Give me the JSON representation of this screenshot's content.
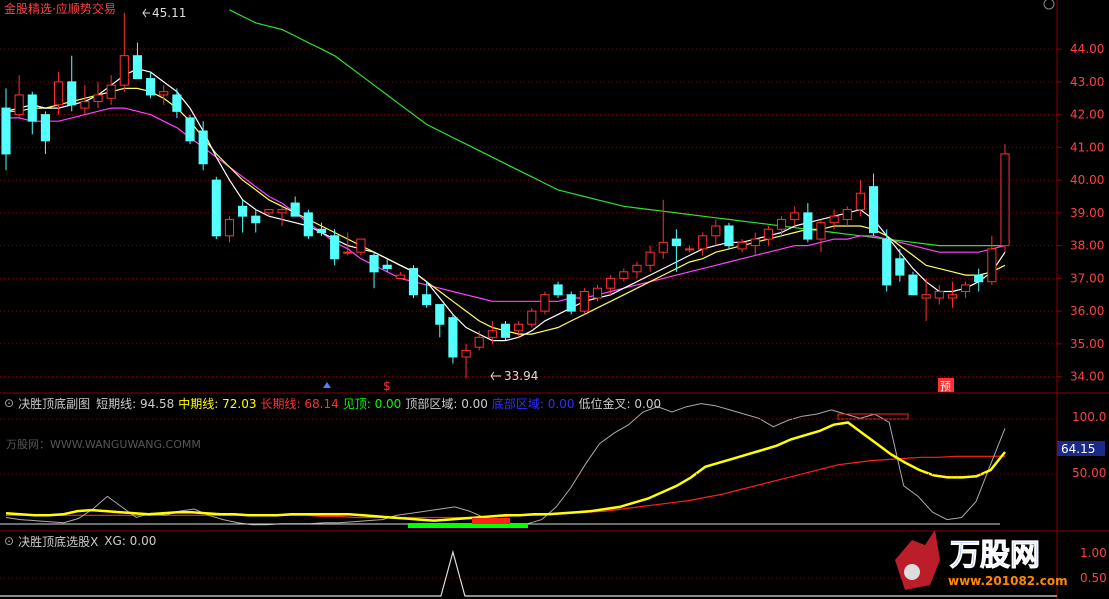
{
  "main_title": "金股精选·应顺势交易",
  "price_axis": {
    "labels": [
      "44.00",
      "43.00",
      "42.00",
      "41.00",
      "40.00",
      "39.00",
      "38.00",
      "37.00",
      "36.00",
      "35.00",
      "34.00"
    ]
  },
  "annotations": {
    "high_label": "45.11",
    "low_label": "33.94",
    "dollar_marker": "$",
    "yu_marker": "预"
  },
  "indicator1": {
    "name": "决胜顶底副图",
    "items": [
      {
        "label": "短期线:",
        "value": "94.58",
        "color": "#cccccc"
      },
      {
        "label": "中期线:",
        "value": "72.03",
        "color": "#ffff00"
      },
      {
        "label": "长期线:",
        "value": "68.14",
        "color": "#ff3030"
      },
      {
        "label": "见顶:",
        "value": "0.00",
        "color": "#00ff00"
      },
      {
        "label": "顶部区域:",
        "value": "0.00",
        "color": "#cccccc"
      },
      {
        "label": "底部区域:",
        "value": "0.00",
        "color": "#3030ff"
      },
      {
        "label": "低位金叉:",
        "value": "0.00",
        "color": "#cccccc"
      }
    ],
    "axis_labels": [
      "100.0",
      "50.00"
    ],
    "current_tag": "64.15",
    "watermark": "万股网：WWW.WANGUWANG.COMM"
  },
  "indicator2": {
    "name": "决胜顶底选股X",
    "items": [
      {
        "label": "XG:",
        "value": "0.00",
        "color": "#cccccc"
      }
    ],
    "axis_labels": [
      "1.00",
      "0.50"
    ]
  },
  "brand": {
    "name": "万股网",
    "url": "www.201082.com"
  },
  "colors": {
    "up": "#ff3030",
    "down": "#54ffff",
    "ma5": "#ffffff",
    "ma10": "#ffff60",
    "ma20": "#ff40ff",
    "ma60": "#30e030",
    "grid": "#8b0000"
  },
  "chart_data": {
    "type": "candlestick",
    "ylim": [
      33.5,
      45.5
    ],
    "candles": [
      [
        42.2,
        42.8,
        40.3,
        40.8
      ],
      [
        42.0,
        43.2,
        41.9,
        42.6
      ],
      [
        42.6,
        42.7,
        41.4,
        41.8
      ],
      [
        42.0,
        42.1,
        40.8,
        41.2
      ],
      [
        42.3,
        43.3,
        42.0,
        43.0
      ],
      [
        43.0,
        43.8,
        42.1,
        42.3
      ],
      [
        42.2,
        42.9,
        42.0,
        42.4
      ],
      [
        42.4,
        43.0,
        42.2,
        42.6
      ],
      [
        42.5,
        43.2,
        42.3,
        42.9
      ],
      [
        42.9,
        45.11,
        42.7,
        43.8
      ],
      [
        43.8,
        44.2,
        43.1,
        43.1
      ],
      [
        43.1,
        43.3,
        42.5,
        42.6
      ],
      [
        42.6,
        42.9,
        42.3,
        42.7
      ],
      [
        42.6,
        42.8,
        41.9,
        42.1
      ],
      [
        41.9,
        42.0,
        41.1,
        41.2
      ],
      [
        41.5,
        41.8,
        40.3,
        40.5
      ],
      [
        40.0,
        40.1,
        38.2,
        38.3
      ],
      [
        38.3,
        38.9,
        38.1,
        38.8
      ],
      [
        39.2,
        39.4,
        38.4,
        38.9
      ],
      [
        38.9,
        39.1,
        38.4,
        38.7
      ],
      [
        39.0,
        39.1,
        38.9,
        39.1
      ],
      [
        39.0,
        39.2,
        38.6,
        39.1
      ],
      [
        39.3,
        39.5,
        38.9,
        38.9
      ],
      [
        39.0,
        39.1,
        38.2,
        38.3
      ],
      [
        38.5,
        38.7,
        38.3,
        38.4
      ],
      [
        38.3,
        38.5,
        37.4,
        37.6
      ],
      [
        37.8,
        38.4,
        37.7,
        37.8
      ],
      [
        37.8,
        38.2,
        37.7,
        38.2
      ],
      [
        37.7,
        37.8,
        36.7,
        37.2
      ],
      [
        37.4,
        37.6,
        37.2,
        37.3
      ],
      [
        37.0,
        37.2,
        37.0,
        37.1
      ],
      [
        37.3,
        37.4,
        36.4,
        36.5
      ],
      [
        36.5,
        36.9,
        36.1,
        36.2
      ],
      [
        36.2,
        36.2,
        35.2,
        35.6
      ],
      [
        35.8,
        35.9,
        34.4,
        34.6
      ],
      [
        34.6,
        35.0,
        33.94,
        34.8
      ],
      [
        34.9,
        35.4,
        34.8,
        35.2
      ],
      [
        35.2,
        35.7,
        35.0,
        35.4
      ],
      [
        35.6,
        35.7,
        35.1,
        35.2
      ],
      [
        35.4,
        35.7,
        35.2,
        35.6
      ],
      [
        35.6,
        36.1,
        35.5,
        36.0
      ],
      [
        36.0,
        36.6,
        35.9,
        36.5
      ],
      [
        36.8,
        36.9,
        36.4,
        36.5
      ],
      [
        36.5,
        36.6,
        35.9,
        36.0
      ],
      [
        36.0,
        36.7,
        35.9,
        36.6
      ],
      [
        36.4,
        36.8,
        36.3,
        36.7
      ],
      [
        36.7,
        37.1,
        36.5,
        37.0
      ],
      [
        37.0,
        37.3,
        36.9,
        37.2
      ],
      [
        37.2,
        37.5,
        37.0,
        37.4
      ],
      [
        37.4,
        38.0,
        37.2,
        37.8
      ],
      [
        37.8,
        39.4,
        37.6,
        38.1
      ],
      [
        38.2,
        38.5,
        37.2,
        38.0
      ],
      [
        37.9,
        38.0,
        37.8,
        37.9
      ],
      [
        37.9,
        38.4,
        37.7,
        38.3
      ],
      [
        38.3,
        38.8,
        38.0,
        38.6
      ],
      [
        38.6,
        38.7,
        37.9,
        38.0
      ],
      [
        37.9,
        38.2,
        37.8,
        38.1
      ],
      [
        38.0,
        38.4,
        37.7,
        38.2
      ],
      [
        38.2,
        38.6,
        38.0,
        38.5
      ],
      [
        38.5,
        38.9,
        38.3,
        38.8
      ],
      [
        38.8,
        39.2,
        38.6,
        39.0
      ],
      [
        39.0,
        39.3,
        38.1,
        38.2
      ],
      [
        38.2,
        38.8,
        37.8,
        38.7
      ],
      [
        38.7,
        39.1,
        38.5,
        38.9
      ],
      [
        38.8,
        39.2,
        38.6,
        39.1
      ],
      [
        39.1,
        40.0,
        38.9,
        39.6
      ],
      [
        39.8,
        40.2,
        38.3,
        38.4
      ],
      [
        38.2,
        38.5,
        36.6,
        36.8
      ],
      [
        37.6,
        37.9,
        36.9,
        37.1
      ],
      [
        37.1,
        37.2,
        36.6,
        36.5
      ],
      [
        36.4,
        37.0,
        35.7,
        36.5
      ],
      [
        36.4,
        36.8,
        36.2,
        36.6
      ],
      [
        36.4,
        36.9,
        36.1,
        36.5
      ],
      [
        36.6,
        36.9,
        36.4,
        36.8
      ],
      [
        37.1,
        37.3,
        36.6,
        36.9
      ],
      [
        36.9,
        38.3,
        36.8,
        37.9
      ],
      [
        38.0,
        41.1,
        37.8,
        40.8
      ]
    ],
    "ma5": [
      42.1,
      42.2,
      42.3,
      42.2,
      42.2,
      42.3,
      42.4,
      42.6,
      42.9,
      43.2,
      43.4,
      43.3,
      43.0,
      42.7,
      42.2,
      41.5,
      40.7,
      40.0,
      39.4,
      39.1,
      38.9,
      38.8,
      38.7,
      38.6,
      38.4,
      38.2,
      38.0,
      37.9,
      37.8,
      37.6,
      37.4,
      37.2,
      36.9,
      36.4,
      35.9,
      35.5,
      35.3,
      35.1,
      35.1,
      35.2,
      35.4,
      35.7,
      35.9,
      36.1,
      36.3,
      36.4,
      36.5,
      36.7,
      36.9,
      37.1,
      37.3,
      37.5,
      37.7,
      37.9,
      38.0,
      38.1,
      38.1,
      38.2,
      38.3,
      38.4,
      38.6,
      38.7,
      38.8,
      38.9,
      39.0,
      39.1,
      38.8,
      38.3,
      37.8,
      37.3,
      36.9,
      36.6,
      36.6,
      36.7,
      36.9,
      37.2,
      37.8
    ],
    "ma10": [
      42.1,
      42.1,
      42.2,
      42.2,
      42.3,
      42.4,
      42.5,
      42.6,
      42.7,
      42.8,
      42.8,
      42.7,
      42.5,
      42.2,
      41.8,
      41.3,
      40.8,
      40.4,
      40.0,
      39.7,
      39.4,
      39.2,
      39.0,
      38.8,
      38.6,
      38.4,
      38.2,
      38.0,
      37.8,
      37.6,
      37.4,
      37.2,
      36.9,
      36.6,
      36.3,
      36.0,
      35.7,
      35.5,
      35.4,
      35.3,
      35.3,
      35.4,
      35.5,
      35.7,
      35.9,
      36.1,
      36.3,
      36.5,
      36.7,
      36.9,
      37.1,
      37.3,
      37.5,
      37.6,
      37.8,
      37.9,
      38.0,
      38.1,
      38.2,
      38.3,
      38.4,
      38.5,
      38.5,
      38.6,
      38.6,
      38.6,
      38.5,
      38.3,
      38.0,
      37.7,
      37.4,
      37.3,
      37.2,
      37.1,
      37.1,
      37.2,
      37.4
    ],
    "ma20": [
      41.9,
      41.9,
      41.8,
      41.8,
      41.8,
      41.9,
      42.0,
      42.1,
      42.2,
      42.2,
      42.1,
      42.0,
      41.8,
      41.6,
      41.3,
      41.0,
      40.7,
      40.4,
      40.1,
      39.8,
      39.5,
      39.3,
      39.0,
      38.7,
      38.4,
      38.1,
      37.9,
      37.6,
      37.4,
      37.2,
      37.0,
      36.9,
      36.8,
      36.7,
      36.6,
      36.5,
      36.4,
      36.3,
      36.3,
      36.3,
      36.3,
      36.3,
      36.3,
      36.4,
      36.4,
      36.5,
      36.6,
      36.7,
      36.8,
      36.9,
      37.0,
      37.1,
      37.2,
      37.3,
      37.4,
      37.5,
      37.6,
      37.7,
      37.8,
      37.9,
      38.0,
      38.0,
      38.1,
      38.2,
      38.2,
      38.3,
      38.3,
      38.2,
      38.1,
      38.0,
      37.9,
      37.8,
      37.8,
      37.8,
      37.8,
      37.9,
      38.0
    ],
    "ma60_from_index": 17,
    "ma60": [
      45.2,
      45.0,
      44.8,
      44.7,
      44.6,
      44.4,
      44.2,
      44.0,
      43.8,
      43.5,
      43.2,
      42.9,
      42.6,
      42.3,
      42.0,
      41.7,
      41.5,
      41.3,
      41.1,
      40.9,
      40.7,
      40.5,
      40.3,
      40.1,
      39.9,
      39.7,
      39.6,
      39.5,
      39.4,
      39.3,
      39.2,
      39.15,
      39.1,
      39.05,
      39.0,
      38.95,
      38.9,
      38.85,
      38.8,
      38.75,
      38.7,
      38.65,
      38.6,
      38.55,
      38.5,
      38.45,
      38.4,
      38.35,
      38.3,
      38.25,
      38.2,
      38.15,
      38.1,
      38.05,
      38.0,
      38.0,
      38.0,
      38.0,
      38.0,
      38.0
    ]
  },
  "chart_data_indicator1": {
    "type": "line",
    "ylim": [
      0,
      110
    ],
    "short": [
      10,
      8,
      7,
      6,
      5,
      9,
      18,
      30,
      20,
      10,
      14,
      12,
      16,
      18,
      12,
      8,
      5,
      3,
      3,
      4,
      4,
      4,
      5,
      5,
      6,
      7,
      8,
      12,
      14,
      16,
      18,
      20,
      16,
      10,
      6,
      4,
      4,
      8,
      20,
      38,
      60,
      80,
      90,
      98,
      110,
      115,
      110,
      115,
      118,
      116,
      112,
      108,
      104,
      96,
      102,
      106,
      108,
      112,
      108,
      104,
      108,
      100,
      40,
      30,
      15,
      8,
      10,
      25,
      60,
      94.58
    ],
    "mid": [
      14,
      13,
      12,
      12,
      13,
      16,
      17,
      16,
      15,
      14,
      13,
      14,
      15,
      15,
      14,
      13,
      13,
      12,
      12,
      12,
      13,
      13,
      13,
      13,
      13,
      12,
      11,
      10,
      9,
      8,
      7,
      8,
      9,
      10,
      11,
      12,
      12,
      13,
      13,
      14,
      15,
      16,
      18,
      20,
      24,
      28,
      34,
      40,
      48,
      58,
      62,
      66,
      70,
      74,
      78,
      84,
      88,
      92,
      98,
      100,
      90,
      80,
      70,
      62,
      55,
      50,
      48,
      48,
      49,
      55,
      72.03
    ],
    "long": [
      12,
      12,
      12,
      12,
      12,
      12,
      12,
      12,
      12,
      12,
      12,
      12,
      12,
      12,
      12,
      12,
      12,
      12,
      12,
      11,
      11,
      10,
      10,
      10,
      10,
      10,
      10,
      10,
      10,
      11,
      11,
      12,
      12,
      13,
      14,
      15,
      16,
      18,
      20,
      22,
      24,
      26,
      29,
      32,
      36,
      40,
      44,
      48,
      52,
      56,
      60,
      62,
      64,
      65,
      66,
      67,
      67,
      68,
      68,
      68,
      68.14
    ],
    "bottom_green_bar": [
      0,
      1
    ],
    "bottom_red_bar": [
      0,
      1
    ]
  },
  "chart_data_indicator2": {
    "type": "line",
    "ylim": [
      0,
      1.1
    ],
    "xg_peak_index": 34
  }
}
